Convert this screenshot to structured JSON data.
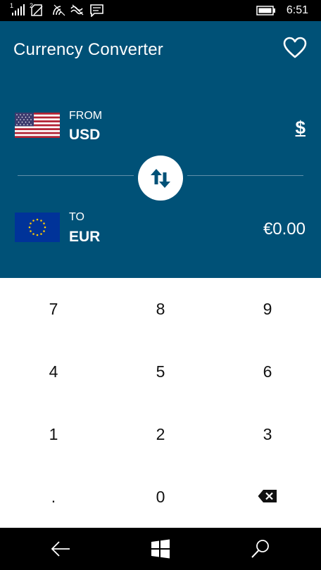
{
  "status_bar": {
    "sim1_label": "1",
    "sim2_label": "2",
    "time": "6:51",
    "icons": [
      "signal-icon",
      "sim2-signal-icon",
      "wifi-icon",
      "data-icon",
      "message-icon",
      "battery-icon"
    ]
  },
  "app": {
    "title": "Currency Converter",
    "favorite_icon": "heart-outline-icon",
    "accent_color": "#005177"
  },
  "from": {
    "label": "FROM",
    "code": "USD",
    "amount": "$",
    "flag": "us-flag"
  },
  "to": {
    "label": "TO",
    "code": "EUR",
    "amount": "€0.00",
    "flag": "eu-flag"
  },
  "swap_icon": "swap-arrows-icon",
  "keypad": {
    "keys": [
      "7",
      "8",
      "9",
      "4",
      "5",
      "6",
      "1",
      "2",
      "3",
      ".",
      "0"
    ],
    "backspace_icon": "backspace-icon"
  },
  "nav_bar": {
    "icons": [
      "back-arrow-icon",
      "windows-icon",
      "search-icon"
    ]
  }
}
